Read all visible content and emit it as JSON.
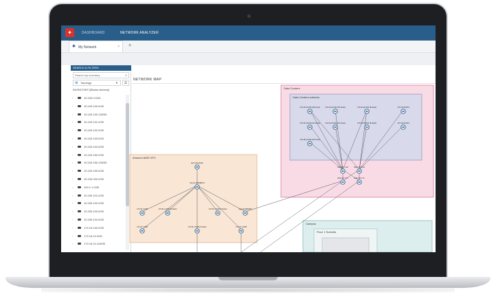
{
  "app": {
    "logo_glyph": "✦",
    "nav": [
      "DASHBOARD",
      "NETWORK ANALYZER"
    ]
  },
  "tabs": [
    {
      "label": "My Network",
      "close": "×"
    }
  ],
  "tab_add": "+",
  "sidebar": {
    "header": "SEARCH & FILTERS",
    "search_placeholder": "Search my inventory",
    "select_value": "Topology",
    "inventory_title": "INVENTORY [Blocks devices]",
    "items": [
      "10.100.0.0/30",
      "10.100.100.0/30",
      "10.100.100.128/30",
      "10.100.101.0/30",
      "10.100.102.0/30",
      "10.100.103.0/30",
      "10.100.104.0/30",
      "10.100.150.0/30",
      "10.100.150.128/30",
      "10.100.159.4/30",
      "10.100.200.0/30",
      "100.1.1.0/30",
      "10.150.101.0/30",
      "10.150.102.0/30",
      "10.150.103.0/30",
      "10.150.104.0/30",
      "172.16.100.0/30",
      "172.16.10.0/30",
      "172.16.10.128/30"
    ]
  },
  "map": {
    "title": "NETWORK MAP",
    "groups": {
      "aws": "Amazon AWS VPC",
      "dc": "Data Centers",
      "dc_sub": "Data Centers subnets",
      "campus": "Campus",
      "floor": "Floor 1 Subnets"
    },
    "aws_nodes": [
      "igw-vb1eeb1ae",
      "rtb-vpc-0b4682bc3",
      "172.31.1.0/28",
      "172.31.1.0/28 (2 hosts)",
      "172.31.1.0/28 (2 hosts)",
      "vgw-ebed9f3a57",
      "172.31.1.0/28",
      "172.31.1.0/28 (2 hosts)",
      "172.31.1.0/28"
    ],
    "dc_nodes": [
      "172.16.10.0/24 (28 hosts)",
      "172.16.12.0/24 (15 hosts)",
      "172.16.22.0/24 (8 hosts)",
      "172.16.33.0/24",
      "172.16.13.0/24 (31 hosts)",
      "172.16.14.0/24 (12 hosts)",
      "172.16.15.0/24 (8 hosts)",
      "172.16.32.0/24",
      "172.16.11.0/24 (22 hosts)",
      "Data-Ctr 1-sw",
      "Data-Ctr 2-sw",
      "Data-Ctr 1-rtr",
      "Data-Ctr 2-rtr"
    ]
  },
  "colors": {
    "accent": "#2a5e8a",
    "logo": "#d9322c",
    "aws_fill": "#f9e6d5",
    "dc_fill": "#f9dbe6",
    "dc_sub_fill": "#d8d9ea",
    "campus_fill": "#dcefee"
  }
}
